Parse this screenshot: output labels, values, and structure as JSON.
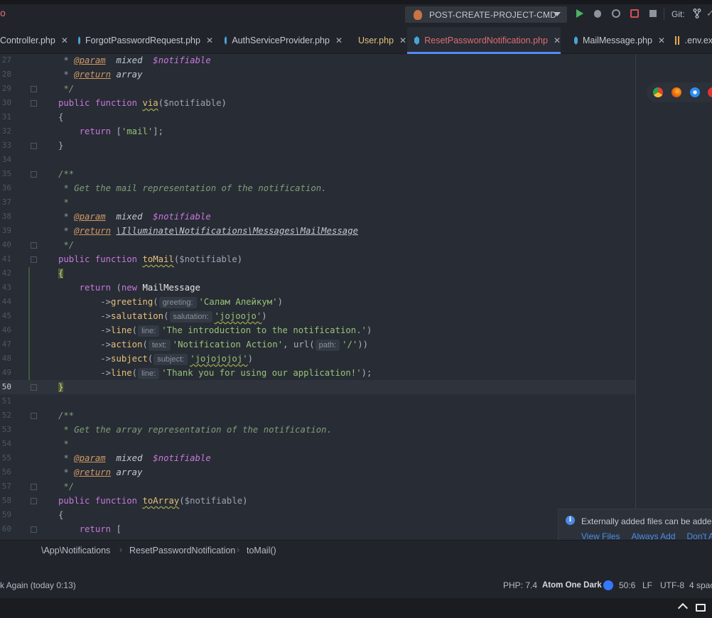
{
  "toolbar": {
    "left_glyph": "o",
    "run_config": "POST-CREATE-PROJECT-CMD",
    "git_label": "Git:"
  },
  "tabs": [
    {
      "label": "Controller.php",
      "icon": "php-file-icon",
      "state": "normal"
    },
    {
      "label": "ForgotPasswordRequest.php",
      "icon": "class-file-icon",
      "state": "normal"
    },
    {
      "label": "AuthServiceProvider.php",
      "icon": "class-file-icon",
      "state": "normal"
    },
    {
      "label": "User.php",
      "icon": "class-file-icon",
      "state": "modified"
    },
    {
      "label": "ResetPasswordNotification.php",
      "icon": "class-file-icon",
      "state": "active"
    },
    {
      "label": "MailMessage.php",
      "icon": "class-file-icon",
      "state": "normal"
    },
    {
      "label": ".env.exa",
      "icon": "env-file-icon",
      "state": "normal"
    }
  ],
  "editor": {
    "current_line": 50,
    "lines": [
      {
        "n": "27",
        "kind": "doc-param",
        "tag": "@param",
        "type": "mixed",
        "var": "$notifiable"
      },
      {
        "n": "28",
        "kind": "doc-return",
        "tag": "@return",
        "type": "array"
      },
      {
        "n": "29",
        "kind": "doc-end",
        "text": " */"
      },
      {
        "n": "30",
        "kind": "fn-decl",
        "kw": "public function",
        "name": "via",
        "arg": "$notifiable"
      },
      {
        "n": "31",
        "kind": "plain",
        "text": "{"
      },
      {
        "n": "32",
        "kind": "return-array",
        "kw": "return",
        "value": "'mail'"
      },
      {
        "n": "33",
        "kind": "plain",
        "text": "}"
      },
      {
        "n": "34",
        "kind": "blank"
      },
      {
        "n": "35",
        "kind": "doc-start",
        "text": "/**"
      },
      {
        "n": "36",
        "kind": "doc-text",
        "text": " * Get the mail representation of the notification."
      },
      {
        "n": "37",
        "kind": "doc-text",
        "text": " *"
      },
      {
        "n": "38",
        "kind": "doc-param",
        "tag": "@param",
        "type": "mixed",
        "var": "$notifiable"
      },
      {
        "n": "39",
        "kind": "doc-return",
        "tag": "@return",
        "type": "\\Illuminate\\Notifications\\Messages\\MailMessage"
      },
      {
        "n": "40",
        "kind": "doc-end",
        "text": " */"
      },
      {
        "n": "41",
        "kind": "fn-decl",
        "kw": "public function",
        "name": "toMail",
        "arg": "$notifiable"
      },
      {
        "n": "42",
        "kind": "brace-hl",
        "text": "{"
      },
      {
        "n": "43",
        "kind": "return-new",
        "kw": "return",
        "new": "new",
        "cls": "MailMessage"
      },
      {
        "n": "44",
        "kind": "chain",
        "method": "greeting",
        "hint": "greeting:",
        "arg": "'Салам Алейкум'",
        "wavy": false,
        "tail": ")"
      },
      {
        "n": "45",
        "kind": "chain",
        "method": "salutation",
        "hint": "salutation:",
        "arg": "'jojoojo'",
        "wavy": true,
        "tail": ")"
      },
      {
        "n": "46",
        "kind": "chain",
        "method": "line",
        "hint": "line:",
        "arg": "'The introduction to the notification.'",
        "wavy": false,
        "tail": ")"
      },
      {
        "n": "47",
        "kind": "chain-action",
        "method": "action",
        "hint": "text:",
        "arg": "'Notification Action'",
        "url": "url",
        "hint2": "path:",
        "arg2": "'/'",
        "tail": "))"
      },
      {
        "n": "48",
        "kind": "chain",
        "method": "subject",
        "hint": "subject:",
        "arg": "'jojojojoj'",
        "wavy": true,
        "tail": ")"
      },
      {
        "n": "49",
        "kind": "chain",
        "method": "line",
        "hint": "line:",
        "arg": "'Thank you for using our application!'",
        "wavy": false,
        "tail": ");"
      },
      {
        "n": "50",
        "kind": "brace-hl",
        "text": "}"
      },
      {
        "n": "51",
        "kind": "blank"
      },
      {
        "n": "52",
        "kind": "doc-start",
        "text": "/**"
      },
      {
        "n": "53",
        "kind": "doc-text",
        "text": " * Get the array representation of the notification."
      },
      {
        "n": "54",
        "kind": "doc-text",
        "text": " *"
      },
      {
        "n": "55",
        "kind": "doc-param",
        "tag": "@param",
        "type": "mixed",
        "var": "$notifiable"
      },
      {
        "n": "56",
        "kind": "doc-return",
        "tag": "@return",
        "type": "array"
      },
      {
        "n": "57",
        "kind": "doc-end",
        "text": " */"
      },
      {
        "n": "58",
        "kind": "fn-decl",
        "kw": "public function",
        "name": "toArray",
        "arg": "$notifiable"
      },
      {
        "n": "59",
        "kind": "plain",
        "text": "{"
      },
      {
        "n": "60",
        "kind": "return-open",
        "kw": "return",
        "text": "["
      }
    ]
  },
  "browsers": [
    "chrome-icon",
    "firefox-icon",
    "safari-icon",
    "opera-icon"
  ],
  "notification": {
    "text": "Externally added files can be added",
    "links": [
      "View Files",
      "Always Add",
      "Don't A"
    ]
  },
  "breadcrumb": [
    "\\App\\Notifications",
    "ResetPasswordNotification",
    "toMail()"
  ],
  "status": {
    "left": "k Again (today 0:13)",
    "php": "PHP: 7.4",
    "theme": "Atom One Dark",
    "position": "50:6",
    "line_sep": "LF",
    "encoding": "UTF-8",
    "indent": "4 spac"
  },
  "colors": {
    "accent": "#568af2",
    "active_tab_text": "#e06c75",
    "run_green": "#4bb464",
    "link_blue": "#4b8fe6"
  }
}
